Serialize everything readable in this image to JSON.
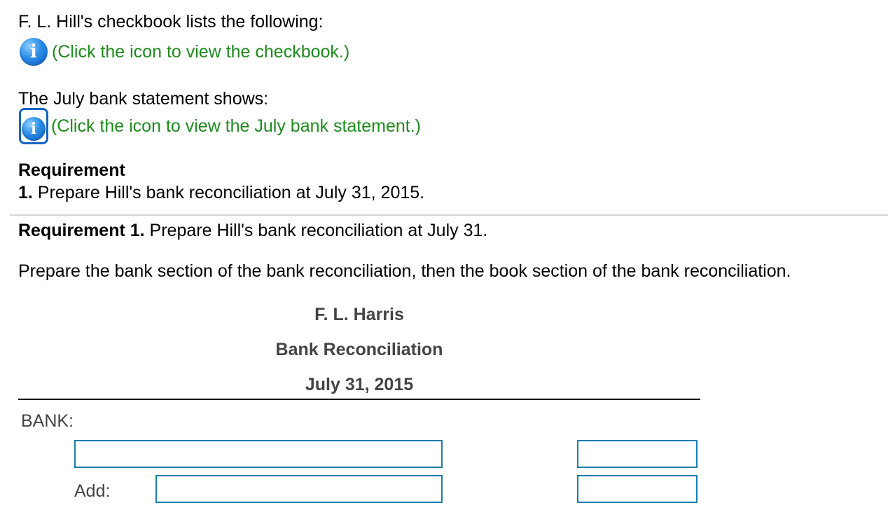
{
  "intro": {
    "checkbook_text": "F. L. Hill's checkbook lists the following:",
    "checkbook_link": "(Click the icon to view the checkbook.)",
    "statement_text": "The July bank statement shows:",
    "statement_link": "(Click the icon to view the July bank statement.)"
  },
  "requirement": {
    "heading": "Requirement",
    "item_number": "1.",
    "item_text": " Prepare Hill's bank reconciliation at July 31, 2015."
  },
  "task": {
    "req_label": "Requirement 1.",
    "req_text": " Prepare Hill's bank reconciliation at July 31.",
    "instruction": "Prepare the bank section of the bank reconciliation, then the book section of the bank reconciliation."
  },
  "reconciliation": {
    "company": "F. L. Harris",
    "title": "Bank Reconciliation",
    "date": "July 31, 2015",
    "bank_label": "BANK:",
    "add_label": "Add:",
    "fields": {
      "bank_desc": "",
      "bank_amount": "",
      "add_desc": "",
      "add_amount": ""
    }
  },
  "icons": {
    "info": "info-icon"
  },
  "colors": {
    "link": "#1e8a1e",
    "input_border": "#1a7ea8",
    "icon_blue": "#2a8be6"
  }
}
